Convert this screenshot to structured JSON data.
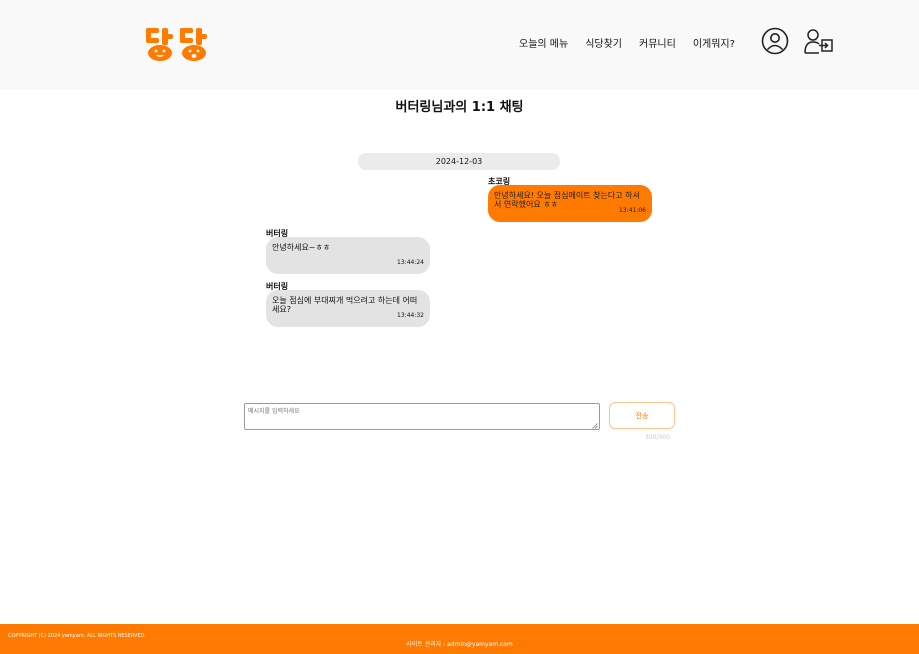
{
  "header": {
    "logo_text": "냠냠",
    "nav": [
      "오늘의 메뉴",
      "식당찾기",
      "커뮤니티",
      "이게뭐지?"
    ]
  },
  "chat": {
    "title": "버터링님과의 1:1 채팅",
    "date": "2024-12-03",
    "messages": [
      {
        "sender": "초코링",
        "text": "안녕하세요! 오늘 점심메이트 찾는다고 하셔서 연락했어요 ㅎㅎ",
        "time": "13:41:06",
        "mine": true
      },
      {
        "sender": "버터링",
        "text": "안녕하세요~ㅎㅎ",
        "time": "13:44:24",
        "mine": false
      },
      {
        "sender": "버터링",
        "text": "오늘 점심에 부대찌개 먹으려고 하는데 어떠세요?",
        "time": "13:44:32",
        "mine": false
      }
    ]
  },
  "composer": {
    "placeholder": "메시지를 입력하세요",
    "send_label": "전송",
    "counter": "300/300"
  },
  "footer": {
    "copyright": "COPYRIGHT (C) 2024 yamyam. ALL RIGHTS RESERVED.",
    "admin": "사이트 관리자 : admin@yamyam.com"
  },
  "colors": {
    "accent": "#ff7a00",
    "bubble_other": "#e3e3e3",
    "header_bg": "#f9f9f9"
  },
  "icons": [
    "user-circle-icon",
    "login-icon"
  ]
}
